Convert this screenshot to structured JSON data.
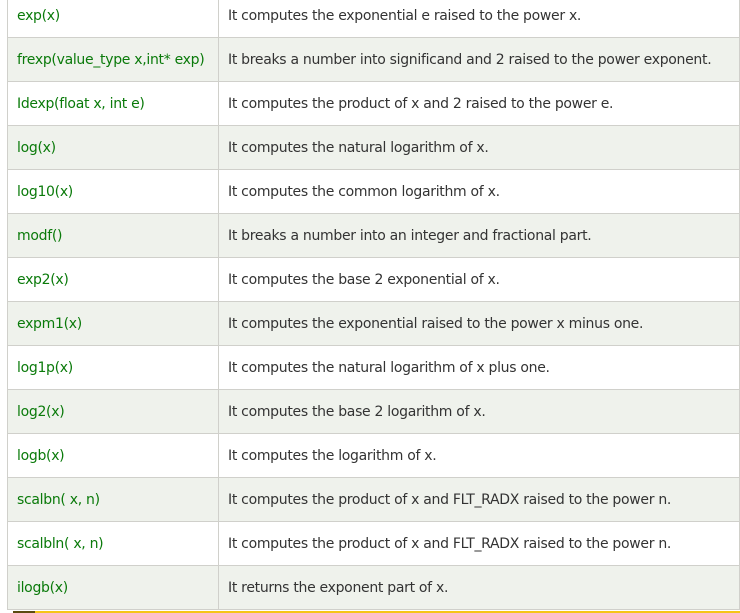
{
  "rows": [
    {
      "fn": "exp(x)",
      "desc": "It computes the exponential e raised to the power x."
    },
    {
      "fn": "frexp(value_type x,int* exp)",
      "desc": "It breaks a number into significand and 2 raised to the power exponent."
    },
    {
      "fn": "Idexp(float x, int e)",
      "desc": "It computes the product of x and 2 raised to the power e."
    },
    {
      "fn": "log(x)",
      "desc": "It computes the natural logarithm of x."
    },
    {
      "fn": "log10(x)",
      "desc": "It computes the common logarithm of x."
    },
    {
      "fn": "modf()",
      "desc": "It breaks a number into an integer and fractional part."
    },
    {
      "fn": "exp2(x)",
      "desc": "It computes the base 2 exponential of x."
    },
    {
      "fn": "expm1(x)",
      "desc": "It computes the exponential raised to the power x minus one."
    },
    {
      "fn": "log1p(x)",
      "desc": "It computes the natural logarithm of x plus one."
    },
    {
      "fn": "log2(x)",
      "desc": "It computes the base 2 logarithm of x."
    },
    {
      "fn": "logb(x)",
      "desc": "It computes the logarithm of x."
    },
    {
      "fn": "scalbn( x, n)",
      "desc": "It computes the product of x and FLT_RADX raised to the power n."
    },
    {
      "fn": "scalbln( x, n)",
      "desc": "It computes the product of x and FLT_RADX raised to the power n."
    },
    {
      "fn": "ilogb(x)",
      "desc": "It returns the exponent part of x."
    }
  ]
}
